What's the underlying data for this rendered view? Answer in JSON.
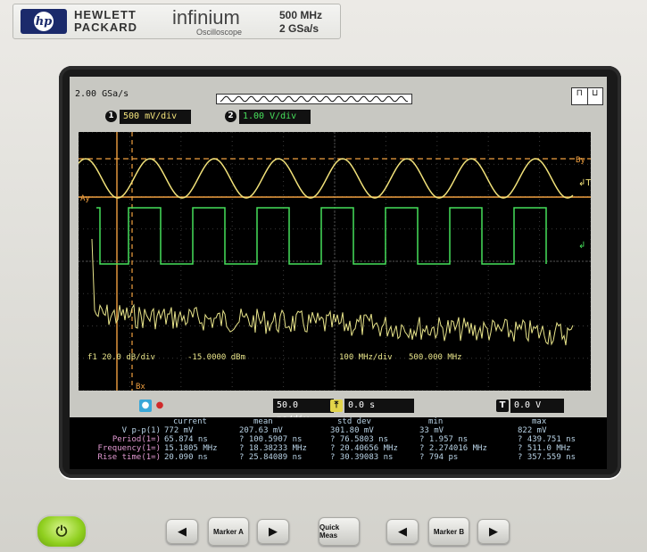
{
  "brand": {
    "logo_text": "hp",
    "company_line1": "HEWLETT",
    "company_line2": "PACKARD",
    "model": "infinium",
    "model_sub": "Oscilloscope",
    "spec_line1": "500 MHz",
    "spec_line2": "2 GSa/s"
  },
  "topbar": {
    "sample_rate": "2.00 GSa/s"
  },
  "channels": [
    {
      "num": "1",
      "scale": "500 mV/div",
      "color": "#f2e27a"
    },
    {
      "num": "2",
      "scale": "1.00 V/div",
      "color": "#46e05b"
    }
  ],
  "trace_labels": {
    "ay": "Ay",
    "by": "By",
    "bx": "Bx",
    "fft": "f1 20.0 dB/div",
    "fft_offset": "-15.0000 dBm",
    "fft_center": "100 MHz/div",
    "fft_span": "500.000 MHz"
  },
  "timebar": {
    "time_div": "50.0 ns/div",
    "delay": "0.0 s",
    "trigger_level": "0.0 V"
  },
  "measurements": {
    "headers": [
      "current",
      "mean",
      "std dev",
      "min",
      "max"
    ],
    "rows": [
      {
        "label": "V p-p(1)",
        "current": "772 mV",
        "mean": "207.63 mV",
        "std": "301.80 mV",
        "min": "33 mV",
        "max": "822 mV"
      },
      {
        "label": "Period(1=)",
        "current": "65.874 ns",
        "mean": "? 100.5907 ns",
        "std": "? 76.5803 ns",
        "min": "? 1.957 ns",
        "max": "? 439.751 ns"
      },
      {
        "label": "Frequency(1=)",
        "current": "15.1805 MHz",
        "mean": "? 18.38233 MHz",
        "std": "? 20.40656 MHz",
        "min": "? 2.274016 MHz",
        "max": "? 511.0 MHz"
      },
      {
        "label": "Rise time(1=)",
        "current": "20.090 ns",
        "mean": "? 25.84089 ns",
        "std": "? 30.39083 ns",
        "min": "? 794 ps",
        "max": "? 357.559 ns"
      }
    ]
  },
  "buttons": {
    "marker_a": "Marker A",
    "marker_b": "Marker B",
    "quick_meas": "Quick Meas",
    "left_arrow": "◀",
    "right_arrow": "▶",
    "power": "⏻"
  }
}
